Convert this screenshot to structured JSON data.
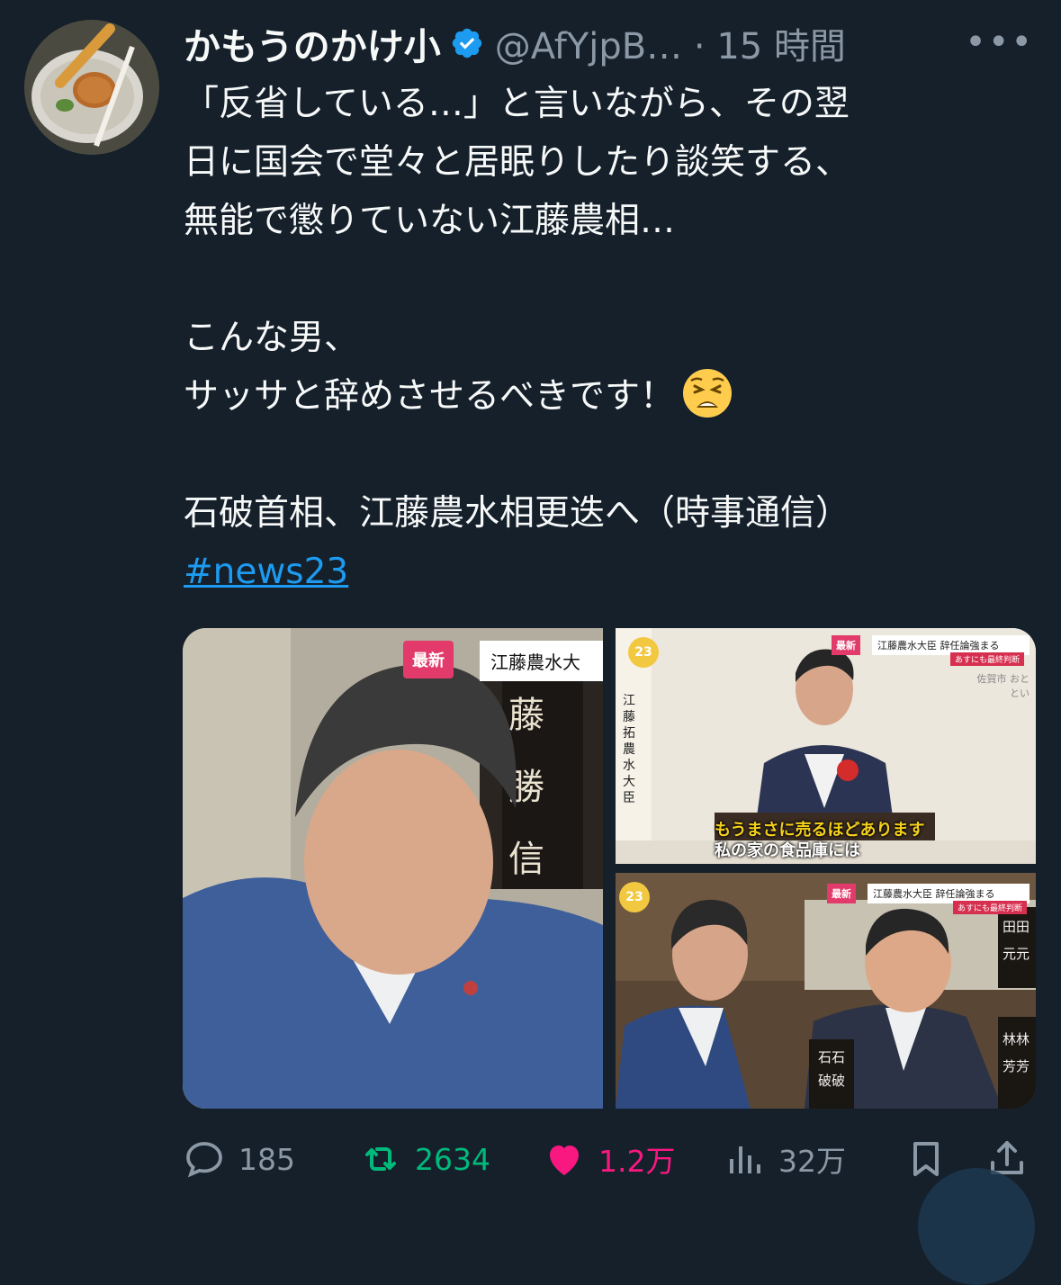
{
  "tweet": {
    "display_name": "かもうのかけ小",
    "handle_time": "@AfYjpB… · 15 時間",
    "more_label": "•••",
    "body_lines": [
      "「反省している…」と言いながら、その翌",
      "日に国会で堂々と居眠りしたり談笑する、",
      "無能で懲りていない江藤農相…",
      "",
      "こんな男、",
      "サッサと辞めさせるべきです！",
      "",
      "石破首相、江藤農水相更迭へ（時事通信）"
    ],
    "hashtag": "#news23",
    "emoji_icon": "weary-face-icon"
  },
  "media": {
    "panel1": {
      "badge": "最新",
      "caption": "江藤農水大",
      "nameplate": "藤 勝 信"
    },
    "panel2": {
      "logo": "23",
      "badge": "最新",
      "headline": "江藤農水大臣 辞任論強まる",
      "subhead": "あすにも最終判断",
      "location": "佐賀市 おととい",
      "side_name": "江藤 拓 農水大臣",
      "caption1": "もうまさに売るほどあります",
      "caption2": "私の家の食品庫には"
    },
    "panel3": {
      "logo": "23",
      "badge": "最新",
      "headline": "江藤農水大臣 辞任論強まる",
      "subhead": "あすにも最終判断",
      "plate_left": "石石 破破",
      "plate_right": "林林 芳芳",
      "plate_top": "田田 元元"
    }
  },
  "actions": {
    "replies": "185",
    "retweets": "2634",
    "likes": "1.2万",
    "views": "32万"
  },
  "colors": {
    "background": "#15202b",
    "secondary_text": "#8b98a5",
    "link": "#1d9bf0",
    "retweet": "#00ba7c",
    "like": "#f91880",
    "verified": "#1d9bf0"
  }
}
